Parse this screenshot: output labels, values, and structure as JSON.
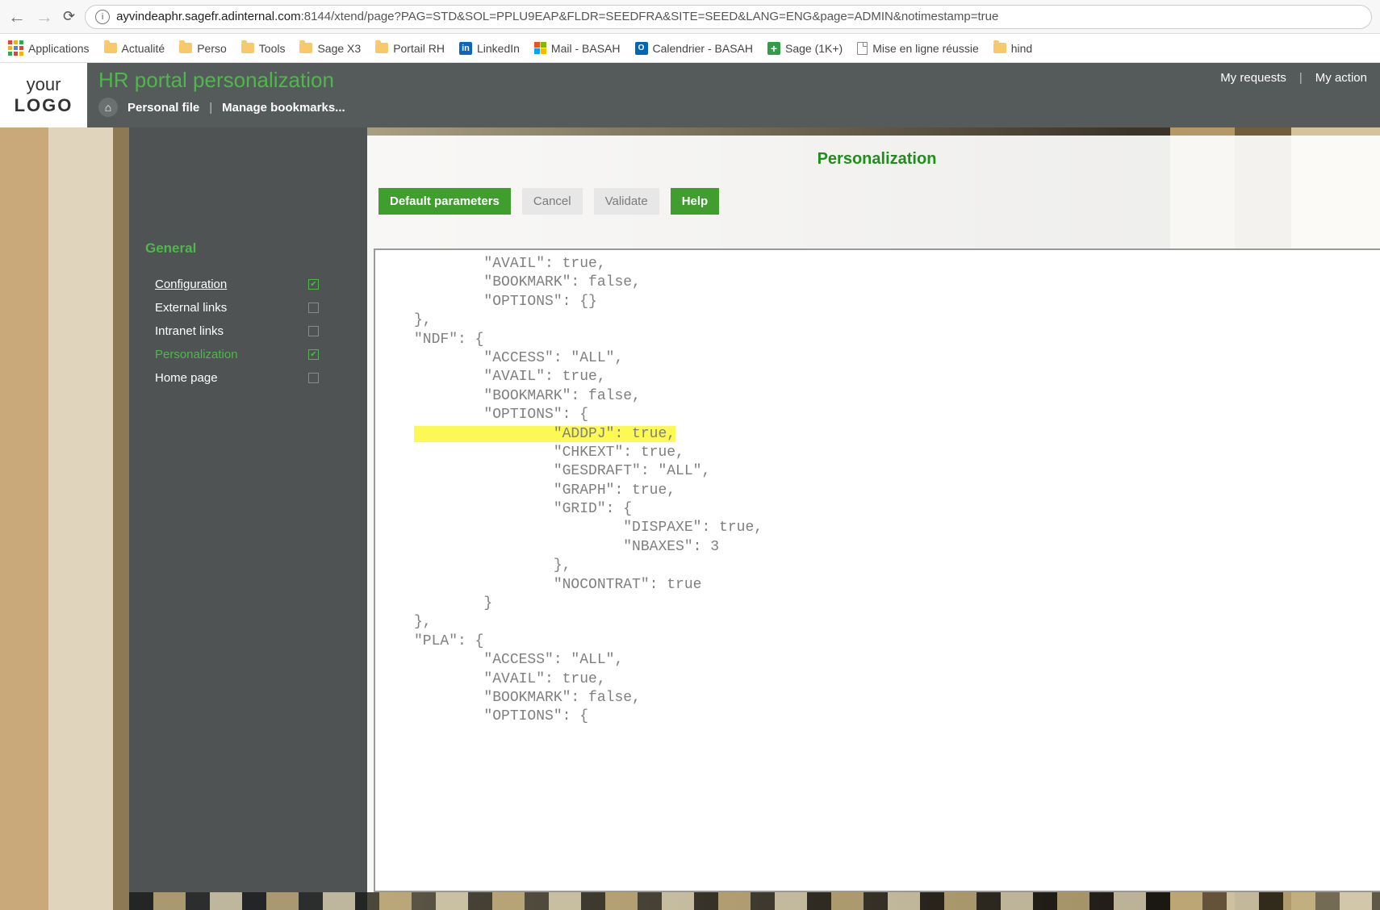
{
  "chrome": {
    "url_host": "ayvindeaphr.sagefr.adinternal.com",
    "url_rest": ":8144/xtend/page?PAG=STD&SOL=PPLU9EAP&FLDR=SEEDFRA&SITE=SEED&LANG=ENG&page=ADMIN&notimestamp=true"
  },
  "bookmarks": {
    "apps": "Applications",
    "items": [
      {
        "icon": "folder",
        "label": "Actualité"
      },
      {
        "icon": "folder",
        "label": "Perso"
      },
      {
        "icon": "folder",
        "label": "Tools"
      },
      {
        "icon": "folder",
        "label": "Sage X3"
      },
      {
        "icon": "folder",
        "label": "Portail RH"
      },
      {
        "icon": "linkedin",
        "label": "LinkedIn"
      },
      {
        "icon": "ms",
        "label": "Mail - BASAH"
      },
      {
        "icon": "outlook",
        "label": "Calendrier - BASAH"
      },
      {
        "icon": "plus",
        "label": "Sage (1K+)"
      },
      {
        "icon": "doc",
        "label": "Mise en ligne réussie"
      },
      {
        "icon": "folder",
        "label": "hind"
      }
    ]
  },
  "header": {
    "logo1": "your",
    "logo2": "LOGO",
    "title": "HR portal personalization",
    "crumbs": {
      "personal_file": "Personal file",
      "manage_bookmarks": "Manage bookmarks..."
    },
    "right": {
      "my_requests": "My requests",
      "my_actions": "My action"
    }
  },
  "sidebar": {
    "heading": "General",
    "items": [
      {
        "label": "Configuration",
        "checked": true,
        "underline": true,
        "active": false
      },
      {
        "label": "External links",
        "checked": false,
        "underline": false,
        "active": false
      },
      {
        "label": "Intranet links",
        "checked": false,
        "underline": false,
        "active": false
      },
      {
        "label": "Personalization",
        "checked": true,
        "underline": false,
        "active": true
      },
      {
        "label": "Home page",
        "checked": false,
        "underline": false,
        "active": false
      }
    ]
  },
  "main": {
    "panel_title": "Personalization",
    "buttons": {
      "default_params": "Default parameters",
      "cancel": "Cancel",
      "validate": "Validate",
      "help": "Help"
    },
    "code_lines": [
      {
        "t": "        \"AVAIL\": true,",
        "hl": false
      },
      {
        "t": "        \"BOOKMARK\": false,",
        "hl": false
      },
      {
        "t": "        \"OPTIONS\": {}",
        "hl": false
      },
      {
        "t": "},",
        "hl": false
      },
      {
        "t": "\"NDF\": {",
        "hl": false
      },
      {
        "t": "        \"ACCESS\": \"ALL\",",
        "hl": false
      },
      {
        "t": "        \"AVAIL\": true,",
        "hl": false
      },
      {
        "t": "        \"BOOKMARK\": false,",
        "hl": false
      },
      {
        "t": "        \"OPTIONS\": {",
        "hl": false
      },
      {
        "t": "                \"ADDPJ\": true,",
        "hl": true
      },
      {
        "t": "                \"CHKEXT\": true,",
        "hl": false
      },
      {
        "t": "                \"GESDRAFT\": \"ALL\",",
        "hl": false
      },
      {
        "t": "                \"GRAPH\": true,",
        "hl": false
      },
      {
        "t": "                \"GRID\": {",
        "hl": false
      },
      {
        "t": "                        \"DISPAXE\": true,",
        "hl": false
      },
      {
        "t": "                        \"NBAXES\": 3",
        "hl": false
      },
      {
        "t": "                },",
        "hl": false
      },
      {
        "t": "                \"NOCONTRAT\": true",
        "hl": false
      },
      {
        "t": "        }",
        "hl": false
      },
      {
        "t": "},",
        "hl": false
      },
      {
        "t": "\"PLA\": {",
        "hl": false
      },
      {
        "t": "        \"ACCESS\": \"ALL\",",
        "hl": false
      },
      {
        "t": "        \"AVAIL\": true,",
        "hl": false
      },
      {
        "t": "        \"BOOKMARK\": false,",
        "hl": false
      },
      {
        "t": "        \"OPTIONS\": {",
        "hl": false
      }
    ]
  }
}
